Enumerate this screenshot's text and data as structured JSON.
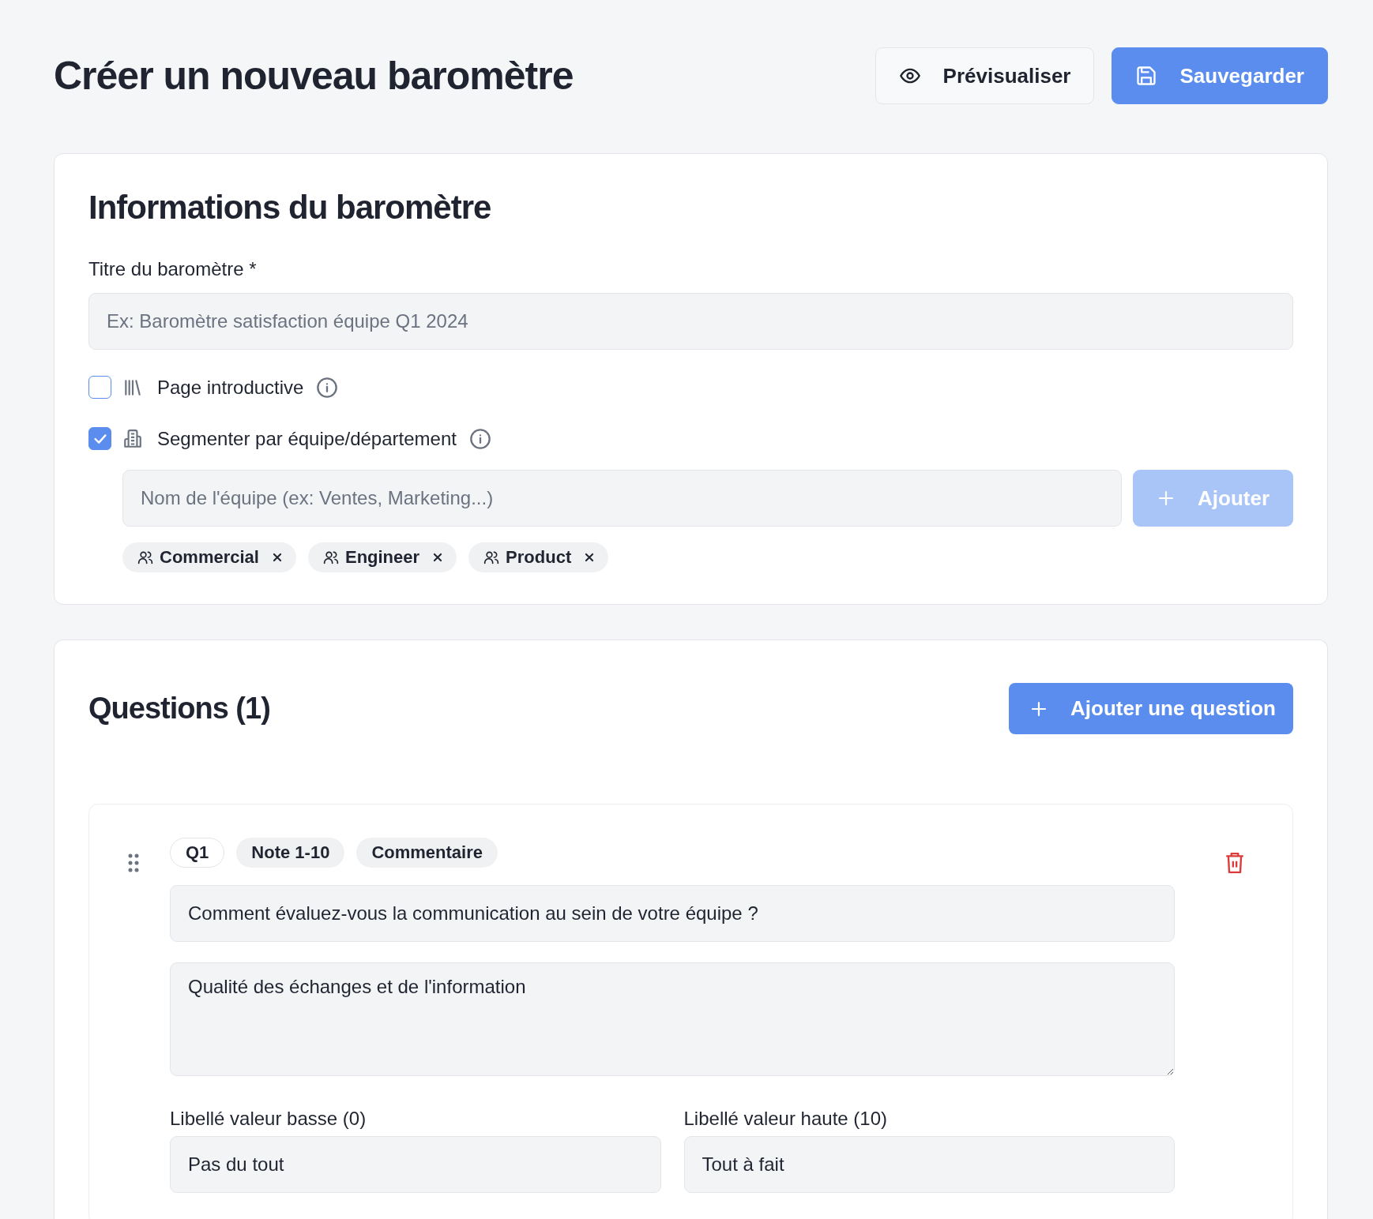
{
  "header": {
    "title": "Créer un nouveau baromètre",
    "actions": [
      {
        "label": "Prévisualiser",
        "kind": "secondary"
      },
      {
        "label": "Sauvegarder",
        "kind": "primary"
      }
    ]
  },
  "info_card": {
    "heading": "Informations du baromètre",
    "title_field": {
      "label": "Titre du baromètre *",
      "placeholder": "Ex: Baromètre satisfaction équipe Q1 2024"
    },
    "options": [
      {
        "label": "Page introductive",
        "checked": false
      },
      {
        "label": "Segmenter par équipe/département",
        "checked": true
      }
    ],
    "team_field": {
      "placeholder": "Nom de l'équipe (ex: Ventes, Marketing...)"
    },
    "add_team_button": {
      "label": "Ajouter",
      "disabled": true
    },
    "teams": [
      {
        "name": "Commercial"
      },
      {
        "name": "Engineer"
      },
      {
        "name": "Product"
      }
    ]
  },
  "questions_card": {
    "heading": "Questions (1)",
    "add_button": "Ajouter une question",
    "questions": [
      {
        "number": "Q1",
        "tags": [
          "Note 1-10",
          "Commentaire"
        ],
        "text": "Comment évaluez-vous la communication au sein de votre équipe ?",
        "description": "Qualité des échanges et de l'information",
        "low": {
          "label": "Libellé valeur basse (0)",
          "value": "Pas du tout"
        },
        "high": {
          "label": "Libellé valeur haute (10)",
          "value": "Tout à fait"
        }
      }
    ]
  }
}
